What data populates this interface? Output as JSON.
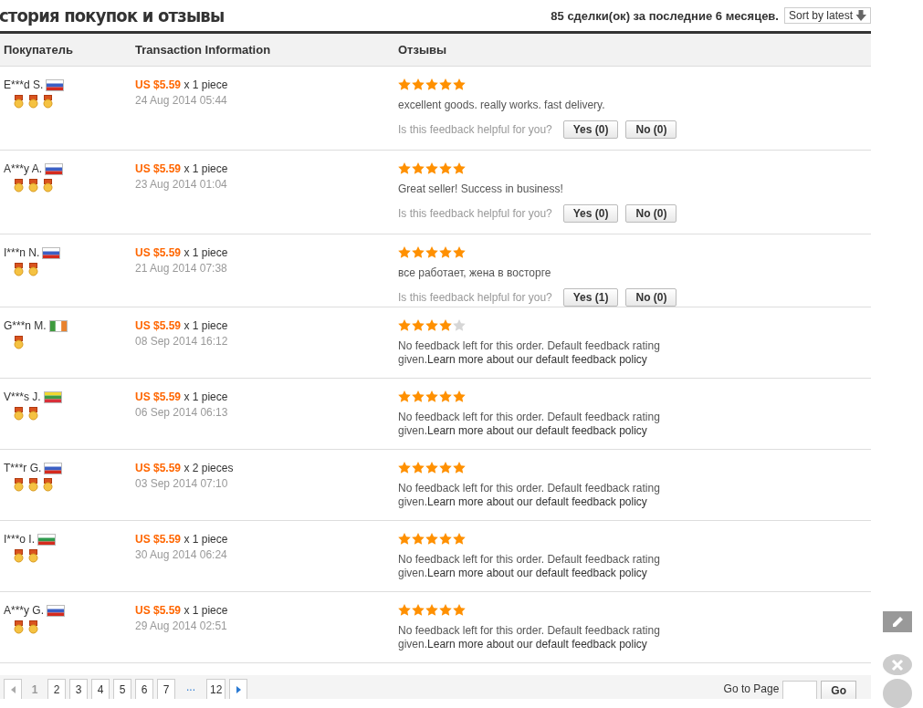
{
  "header": {
    "title": "стория покупок и отзывы",
    "summary": "85 сделки(ок) за последние 6 месяцев.",
    "sort": "Sort by latest"
  },
  "table": {
    "columns": [
      "Покупатель",
      "Transaction Information",
      "Отзывы"
    ],
    "rows": [
      {
        "buyer": "E***d S.",
        "flag": {
          "kind": "horizontal",
          "stripes": [
            {
              "color": "#ffffff"
            },
            {
              "color": "#3b5fc4"
            },
            {
              "color": "#d52b1e"
            }
          ]
        },
        "badges": [
          {
            "kind": "medal"
          },
          {
            "kind": "medal"
          },
          {
            "kind": "medal"
          }
        ],
        "price": "US $5.59",
        "quantity": "x 1 piece",
        "date": "24 Aug 2014 05:44",
        "stars": 5,
        "kind": "comment",
        "text": "excellent goods. really works. fast delivery.",
        "helpful": "Is this feedback helpful for you?",
        "yes": "Yes (0)",
        "no": "No (0)"
      },
      {
        "buyer": "A***y A.",
        "flag": {
          "kind": "horizontal",
          "stripes": [
            {
              "color": "#ffffff"
            },
            {
              "color": "#3b5fc4"
            },
            {
              "color": "#d52b1e"
            }
          ]
        },
        "badges": [
          {
            "kind": "medal"
          },
          {
            "kind": "medal"
          },
          {
            "kind": "medal"
          }
        ],
        "price": "US $5.59",
        "quantity": "x 1 piece",
        "date": "23 Aug 2014 01:04",
        "stars": 5,
        "kind": "comment",
        "text": "Great seller! Success in business!",
        "helpful": "Is this feedback helpful for you?",
        "yes": "Yes (0)",
        "no": "No (0)"
      },
      {
        "buyer": "I***n N.",
        "flag": {
          "kind": "horizontal",
          "stripes": [
            {
              "color": "#ffffff"
            },
            {
              "color": "#3b5fc4"
            },
            {
              "color": "#d52b1e"
            }
          ]
        },
        "badges": [
          {
            "kind": "medal"
          },
          {
            "kind": "medal"
          }
        ],
        "price": "US $5.59",
        "quantity": "x 1 piece",
        "date": "21 Aug 2014 07:38",
        "stars": 5,
        "kind": "comment",
        "text": "все работает, жена в восторге",
        "helpful": "Is this feedback helpful for you?",
        "yes": "Yes (1)",
        "no": "No (0)"
      },
      {
        "buyer": "G***n M.",
        "flag": {
          "kind": "vertical",
          "stripes": [
            {
              "color": "#3e9a3e"
            },
            {
              "color": "#ffffff"
            },
            {
              "color": "#e8822e"
            }
          ]
        },
        "badges": [
          {
            "kind": "medal"
          }
        ],
        "price": "US $5.59",
        "quantity": "x 1 piece",
        "date": "08 Sep 2014 16:12",
        "stars": 4,
        "kind": "default",
        "text": "No feedback left for this order. Default feedback rating given.",
        "link": "Learn more about our default feedback policy"
      },
      {
        "buyer": "V***s J.",
        "flag": {
          "kind": "horizontal",
          "stripes": [
            {
              "color": "#f1d830"
            },
            {
              "color": "#3d9a45"
            },
            {
              "color": "#d8303a"
            }
          ]
        },
        "badges": [
          {
            "kind": "medal"
          },
          {
            "kind": "medal"
          }
        ],
        "price": "US $5.59",
        "quantity": "x 1 piece",
        "date": "06 Sep 2014 06:13",
        "stars": 5,
        "kind": "default",
        "text": "No feedback left for this order. Default feedback rating given.",
        "link": "Learn more about our default feedback policy"
      },
      {
        "buyer": "T***r G.",
        "flag": {
          "kind": "horizontal",
          "stripes": [
            {
              "color": "#ffffff"
            },
            {
              "color": "#3b5fc4"
            },
            {
              "color": "#d52b1e"
            }
          ]
        },
        "badges": [
          {
            "kind": "medal"
          },
          {
            "kind": "medal"
          },
          {
            "kind": "medal"
          }
        ],
        "price": "US $5.59",
        "quantity": "x 2 pieces",
        "date": "03 Sep 2014 07:10",
        "stars": 5,
        "kind": "default",
        "text": "No feedback left for this order. Default feedback rating given.",
        "link": "Learn more about our default feedback policy"
      },
      {
        "buyer": "I***o I.",
        "flag": {
          "kind": "horizontal",
          "stripes": [
            {
              "color": "#ffffff"
            },
            {
              "color": "#2f9a4e"
            },
            {
              "color": "#d52b1e"
            }
          ]
        },
        "badges": [
          {
            "kind": "medal"
          },
          {
            "kind": "medal"
          }
        ],
        "price": "US $5.59",
        "quantity": "x 1 piece",
        "date": "30 Aug 2014 06:24",
        "stars": 5,
        "kind": "default",
        "text": "No feedback left for this order. Default feedback rating given.",
        "link": "Learn more about our default feedback policy"
      },
      {
        "buyer": "A***y G.",
        "flag": {
          "kind": "horizontal",
          "stripes": [
            {
              "color": "#ffffff"
            },
            {
              "color": "#3b5fc4"
            },
            {
              "color": "#d52b1e"
            }
          ]
        },
        "badges": [
          {
            "kind": "medal"
          },
          {
            "kind": "medal"
          }
        ],
        "price": "US $5.59",
        "quantity": "x 1 piece",
        "date": "29 Aug 2014 02:51",
        "stars": 5,
        "kind": "default",
        "text": "No feedback left for this order. Default feedback rating given.",
        "link": "Learn more about our default feedback policy"
      }
    ]
  },
  "pagination": {
    "prev_disabled": true,
    "pages": [
      {
        "label": "1",
        "selected": true
      },
      {
        "label": "2",
        "selected": false
      },
      {
        "label": "3",
        "selected": false
      },
      {
        "label": "4",
        "selected": false
      },
      {
        "label": "5",
        "selected": false
      },
      {
        "label": "6",
        "selected": false
      },
      {
        "label": "7",
        "selected": false
      },
      {
        "label": "...",
        "kind": "gap"
      },
      {
        "label": "12",
        "selected": false
      }
    ],
    "goto_label": "Go to Page",
    "go": "Go"
  }
}
